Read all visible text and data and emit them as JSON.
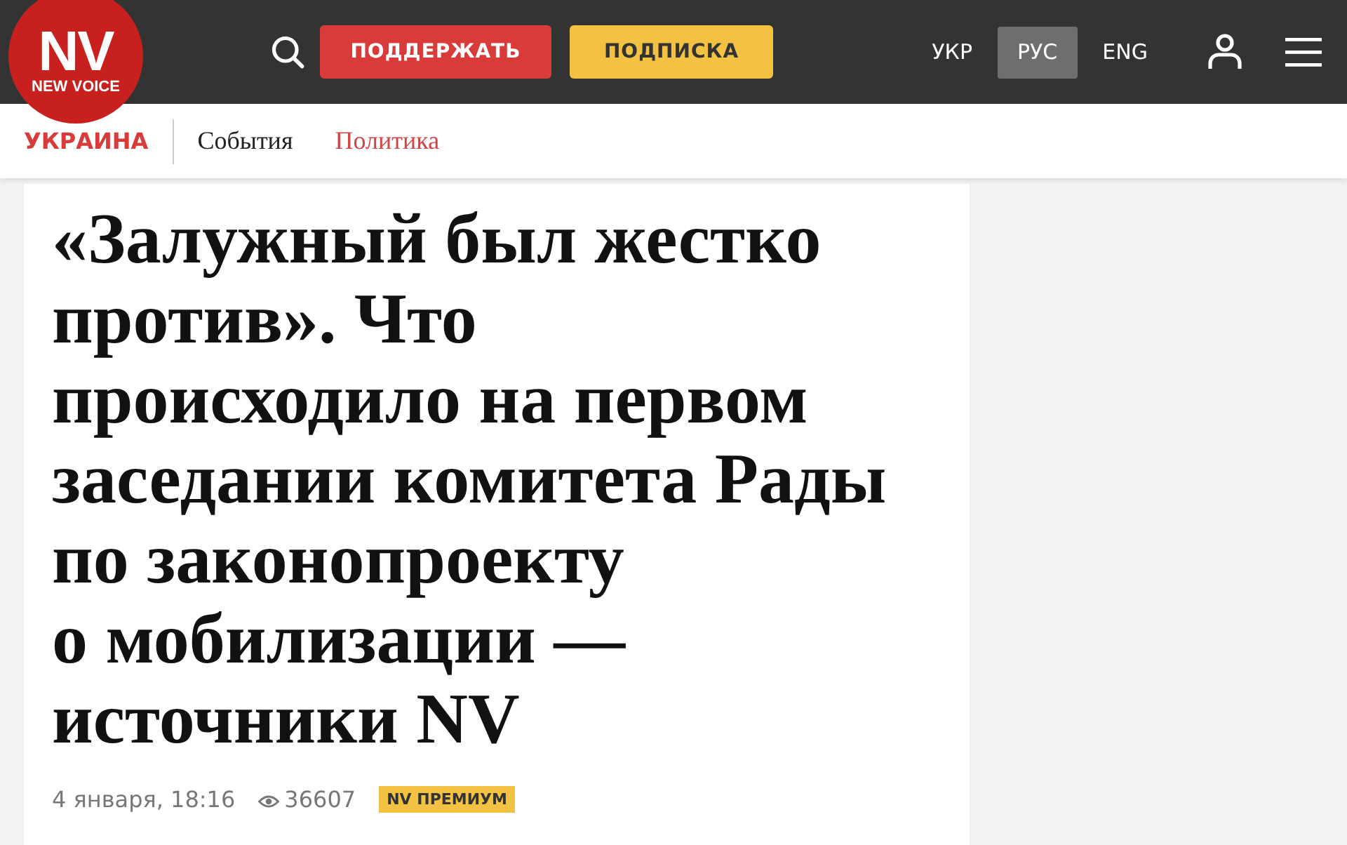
{
  "logo": {
    "mark": "NV",
    "caption": "NEW VOICE"
  },
  "header": {
    "buttons": [
      {
        "label": "ПОДДЕРЖАТЬ",
        "kind": "support"
      },
      {
        "label": "ПОДПИСКА",
        "kind": "subscribe"
      }
    ],
    "languages": [
      {
        "label": "УКР",
        "selected": false
      },
      {
        "label": "РУС",
        "selected": true
      },
      {
        "label": "ENG",
        "selected": false
      }
    ]
  },
  "breadcrumbs": {
    "section": "УКРАИНА",
    "items": [
      {
        "label": "События",
        "selected": false
      },
      {
        "label": "Политика",
        "selected": true
      }
    ]
  },
  "article": {
    "title": "«Залужный был жестко\nпротив». Что\nпроисходило на первом\nзаседании комитета Рады\nпо законопроекту\nо мобилизации —\nисточники NV",
    "date": "4 января, 18:16",
    "views": "36607",
    "badge": "NV ПРЕМИУМ"
  }
}
